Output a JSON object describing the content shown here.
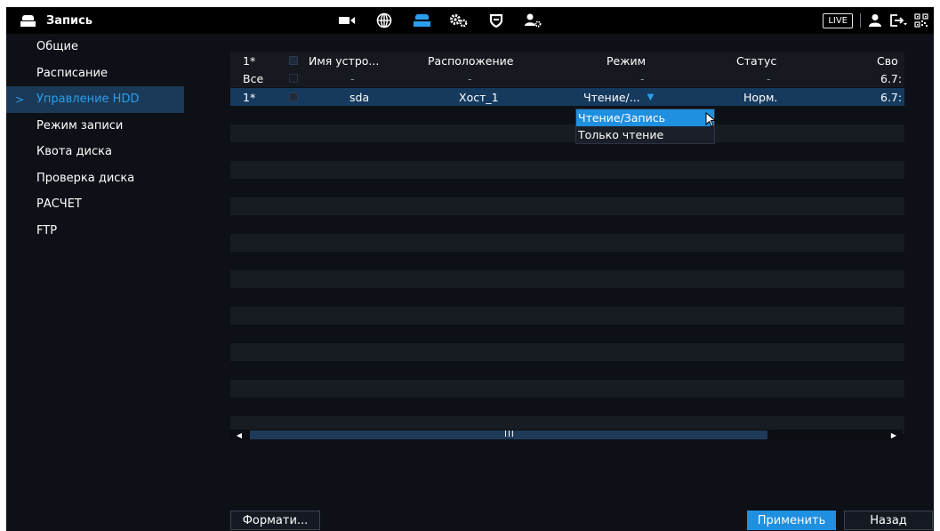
{
  "topbar": {
    "title": "Запись",
    "live_label": "LIVE",
    "nav_icons": [
      "camera-icon",
      "network-icon",
      "storage-icon",
      "settings-gears-icon",
      "shield-icon",
      "account-settings-icon"
    ],
    "active_icon": "storage-icon"
  },
  "sidebar": {
    "items": [
      {
        "label": "Общие",
        "active": false
      },
      {
        "label": "Расписание",
        "active": false
      },
      {
        "label": "Управление HDD",
        "active": true
      },
      {
        "label": "Режим записи",
        "active": false
      },
      {
        "label": "Квота диска",
        "active": false
      },
      {
        "label": "Проверка диска",
        "active": false
      },
      {
        "label": "РАСЧЕТ",
        "active": false
      },
      {
        "label": "FTP",
        "active": false
      }
    ]
  },
  "table": {
    "headers": {
      "index": "1*",
      "device_name": "Имя устро...",
      "location": "Расположение",
      "mode": "Режим",
      "status": "Статус",
      "free": "Сво"
    },
    "all_row": {
      "index": "Все",
      "device_name": "-",
      "location": "-",
      "mode": "-",
      "status": "-",
      "free": "6.7:"
    },
    "disk_row": {
      "index": "1*",
      "device_name": "sda",
      "location": "Хост_1",
      "mode": "Чтение/...",
      "status": "Норм.",
      "free": "6.7:"
    },
    "mode_options": [
      "Чтение/Запись",
      "Только чтение"
    ],
    "highlighted_option": "Чтение/Запись"
  },
  "buttons": {
    "format": "Формати...",
    "apply": "Применить",
    "back": "Назад"
  },
  "colors": {
    "accent": "#1f8fe0",
    "background": "#0d1117",
    "topbar": "#000000",
    "selected_row": "#163a5e",
    "active_menu": "#1b3a57"
  }
}
